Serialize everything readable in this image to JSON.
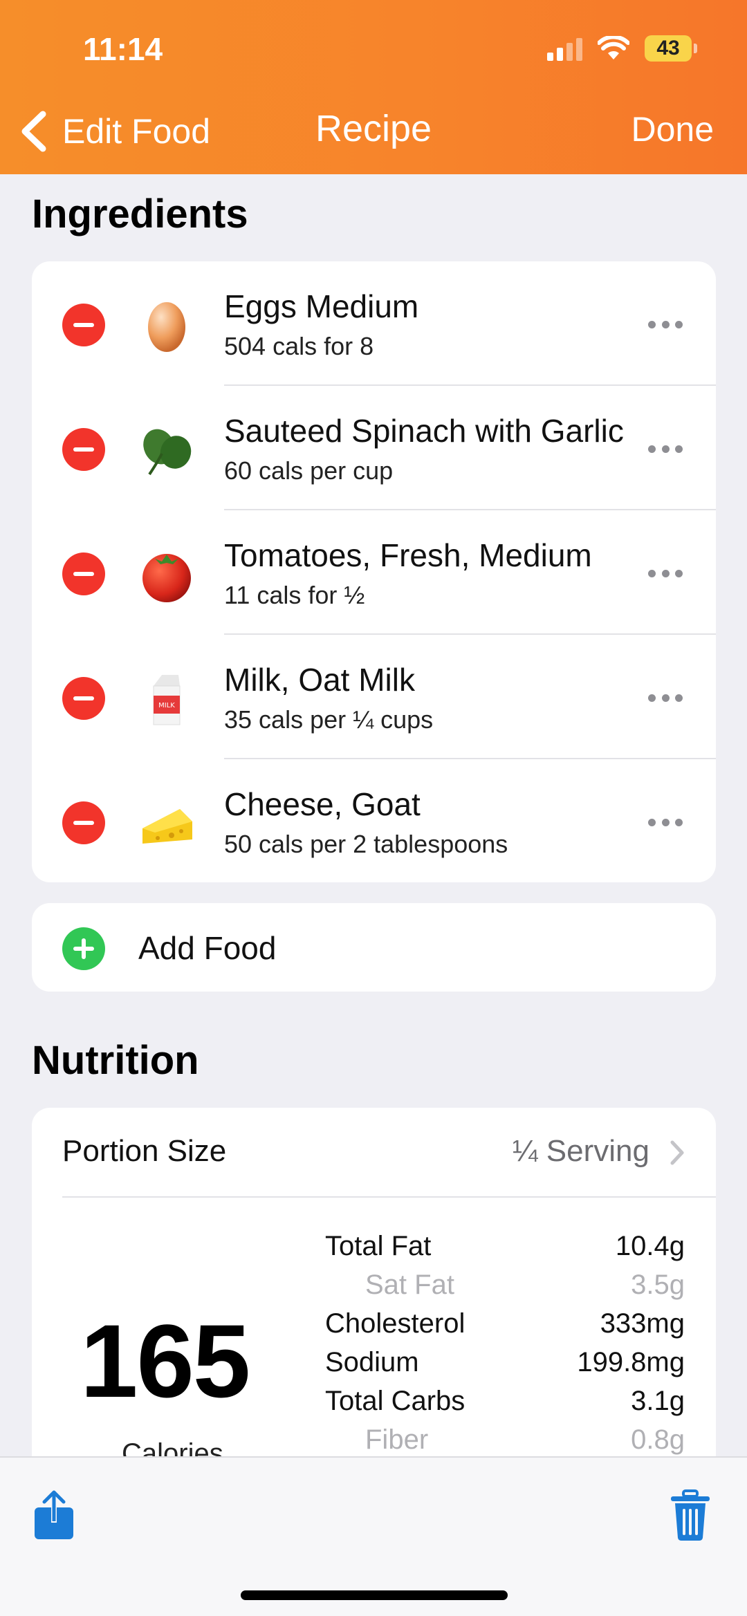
{
  "status_bar": {
    "time": "11:14",
    "battery": "43"
  },
  "nav": {
    "back_label": "Edit Food",
    "title": "Recipe",
    "done_label": "Done"
  },
  "ingredients": {
    "title": "Ingredients",
    "items": [
      {
        "name": "Eggs Medium",
        "cals": "504 cals for 8",
        "icon": "egg-icon"
      },
      {
        "name": "Sauteed Spinach with Garlic",
        "cals": "60 cals per cup",
        "icon": "spinach-icon"
      },
      {
        "name": "Tomatoes, Fresh, Medium",
        "cals": "11 cals for ½",
        "icon": "tomato-icon"
      },
      {
        "name": "Milk, Oat Milk",
        "cals": "35 cals per ¼ cups",
        "icon": "milk-carton-icon",
        "icon_text": "MILK"
      },
      {
        "name": "Cheese, Goat",
        "cals": "50 cals per 2 tablespoons",
        "icon": "cheese-icon"
      }
    ],
    "add_label": "Add Food"
  },
  "nutrition": {
    "title": "Nutrition",
    "portion_label": "Portion Size",
    "portion_value": "¼ Serving",
    "calories_value": "165",
    "calories_label": "Calories",
    "rows": [
      {
        "label": "Total Fat",
        "value": "10.4g"
      },
      {
        "label": "Sat Fat",
        "value": "3.5g"
      },
      {
        "label": "Cholesterol",
        "value": "333mg"
      },
      {
        "label": "Sodium",
        "value": "199.8mg"
      },
      {
        "label": "Total Carbs",
        "value": "3.1g"
      },
      {
        "label": "Fiber",
        "value": "0.8g"
      }
    ]
  },
  "colors": {
    "header": "#f7832b",
    "remove": "#f2342b",
    "add": "#31c755",
    "accent_blue": "#1c7cd6"
  }
}
